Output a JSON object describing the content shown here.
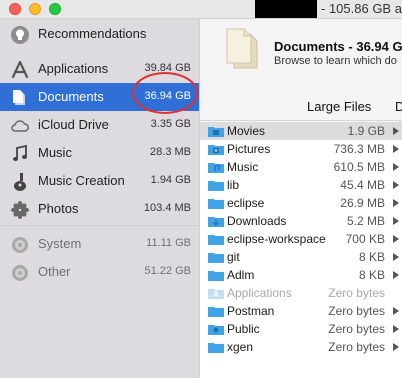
{
  "window": {
    "title_text": "- 105.86 GB av"
  },
  "sidebar": {
    "items": [
      {
        "label": "Recommendations",
        "size": "",
        "icon": "lightbulb-icon"
      },
      {
        "label": "Applications",
        "size": "39.84 GB",
        "icon": "app-store-icon"
      },
      {
        "label": "Documents",
        "size": "36.94 GB",
        "icon": "documents-icon",
        "selected": true
      },
      {
        "label": "iCloud Drive",
        "size": "3.35 GB",
        "icon": "cloud-icon"
      },
      {
        "label": "Music",
        "size": "28.3 MB",
        "icon": "music-note-icon"
      },
      {
        "label": "Music Creation",
        "size": "1.94 GB",
        "icon": "guitar-icon"
      },
      {
        "label": "Photos",
        "size": "103.4 MB",
        "icon": "photos-icon"
      },
      {
        "label": "System",
        "size": "11.11 GB",
        "icon": "disk-icon"
      },
      {
        "label": "Other",
        "size": "51.22 GB",
        "icon": "disk-icon"
      }
    ]
  },
  "header": {
    "title": "Documents - 36.94 G",
    "subtitle": "Browse to learn which do"
  },
  "tabs": [
    "Large Files",
    "D"
  ],
  "files": [
    {
      "name": "Movies",
      "size": "1.9 GB",
      "icon": "movies-folder-icon"
    },
    {
      "name": "Pictures",
      "size": "736.3 MB",
      "icon": "pictures-folder-icon"
    },
    {
      "name": "Music",
      "size": "610.5 MB",
      "icon": "music-folder-icon"
    },
    {
      "name": "lib",
      "size": "45.4 MB",
      "icon": "folder-icon"
    },
    {
      "name": "eclipse",
      "size": "26.9 MB",
      "icon": "folder-icon"
    },
    {
      "name": "Downloads",
      "size": "5.2 MB",
      "icon": "downloads-folder-icon"
    },
    {
      "name": "eclipse-workspace",
      "size": "700 KB",
      "icon": "folder-icon"
    },
    {
      "name": "git",
      "size": "8 KB",
      "icon": "folder-icon"
    },
    {
      "name": "Adlm",
      "size": "8 KB",
      "icon": "folder-icon"
    },
    {
      "name": "Applications",
      "size": "Zero bytes",
      "icon": "applications-folder-icon"
    },
    {
      "name": "Postman",
      "size": "Zero bytes",
      "icon": "folder-icon"
    },
    {
      "name": "Public",
      "size": "Zero bytes",
      "icon": "public-folder-icon"
    },
    {
      "name": "xgen",
      "size": "Zero bytes",
      "icon": "folder-icon"
    }
  ],
  "colors": {
    "accent": "#2f6fd6",
    "folder": "#3fa3e6",
    "annotation": "#e0312f"
  }
}
